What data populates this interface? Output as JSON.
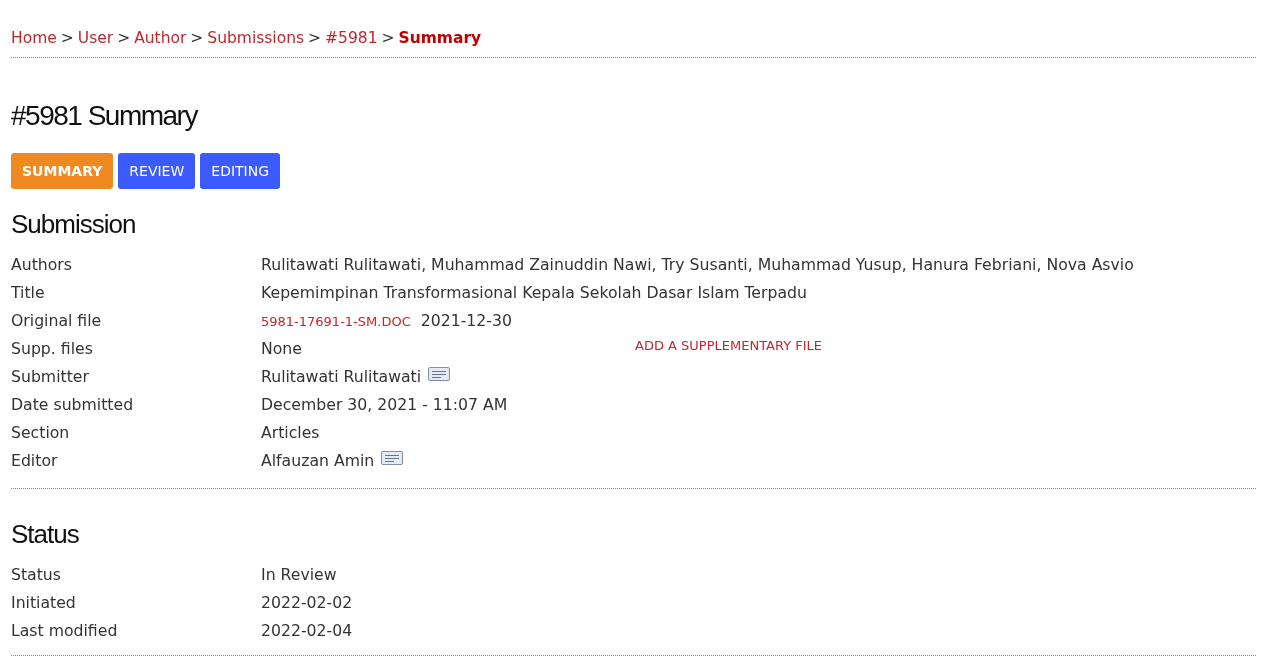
{
  "breadcrumb": [
    {
      "label": "Home",
      "current": false
    },
    {
      "separator": ">",
      "label": "User",
      "current": false
    },
    {
      "separator": ">",
      "label": "Author",
      "current": false
    },
    {
      "separator": ">",
      "label": "Submissions",
      "current": false
    },
    {
      "separator": ">",
      "label": "#5981",
      "current": false
    },
    {
      "separator": ">",
      "label": "Summary",
      "current": true
    }
  ],
  "page_title": "#5981 Summary",
  "tabs": [
    {
      "label": "SUMMARY",
      "selected": true
    },
    {
      "label": "REVIEW",
      "selected": false
    },
    {
      "label": "EDITING",
      "selected": false
    }
  ],
  "sections": [
    {
      "title": "Submission",
      "rows": [
        {
          "kind": "text",
          "label": "Authors",
          "value": "Rulitawati Rulitawati, Muhammad Zainuddin Nawi, Try Susanti, Muhammad Yusup, Hanura Febriani, Nova Asvio"
        },
        {
          "kind": "text",
          "label": "Title",
          "value": "Kepemimpinan Transformasional Kepala Sekolah Dasar Islam Terpadu"
        },
        {
          "kind": "file",
          "label": "Original file",
          "file": "5981-17691-1-SM.DOC",
          "value": "2021-12-30"
        },
        {
          "kind": "supp",
          "label": "Supp. files",
          "value": "None",
          "action": "ADD A SUPPLEMENTARY FILE"
        },
        {
          "kind": "contact",
          "label": "Submitter",
          "value": "Rulitawati Rulitawati"
        },
        {
          "kind": "text",
          "label": "Date submitted",
          "value": "December 30, 2021 - 11:07 AM"
        },
        {
          "kind": "text",
          "label": "Section",
          "value": "Articles"
        },
        {
          "kind": "contact",
          "label": "Editor",
          "value": "Alfauzan Amin"
        }
      ]
    },
    {
      "title": "Status",
      "rows": [
        {
          "kind": "text",
          "label": "Status",
          "value": "In Review"
        },
        {
          "kind": "text",
          "label": "Initiated",
          "value": "2022-02-02"
        },
        {
          "kind": "text",
          "label": "Last modified",
          "value": "2022-02-04"
        }
      ]
    }
  ]
}
